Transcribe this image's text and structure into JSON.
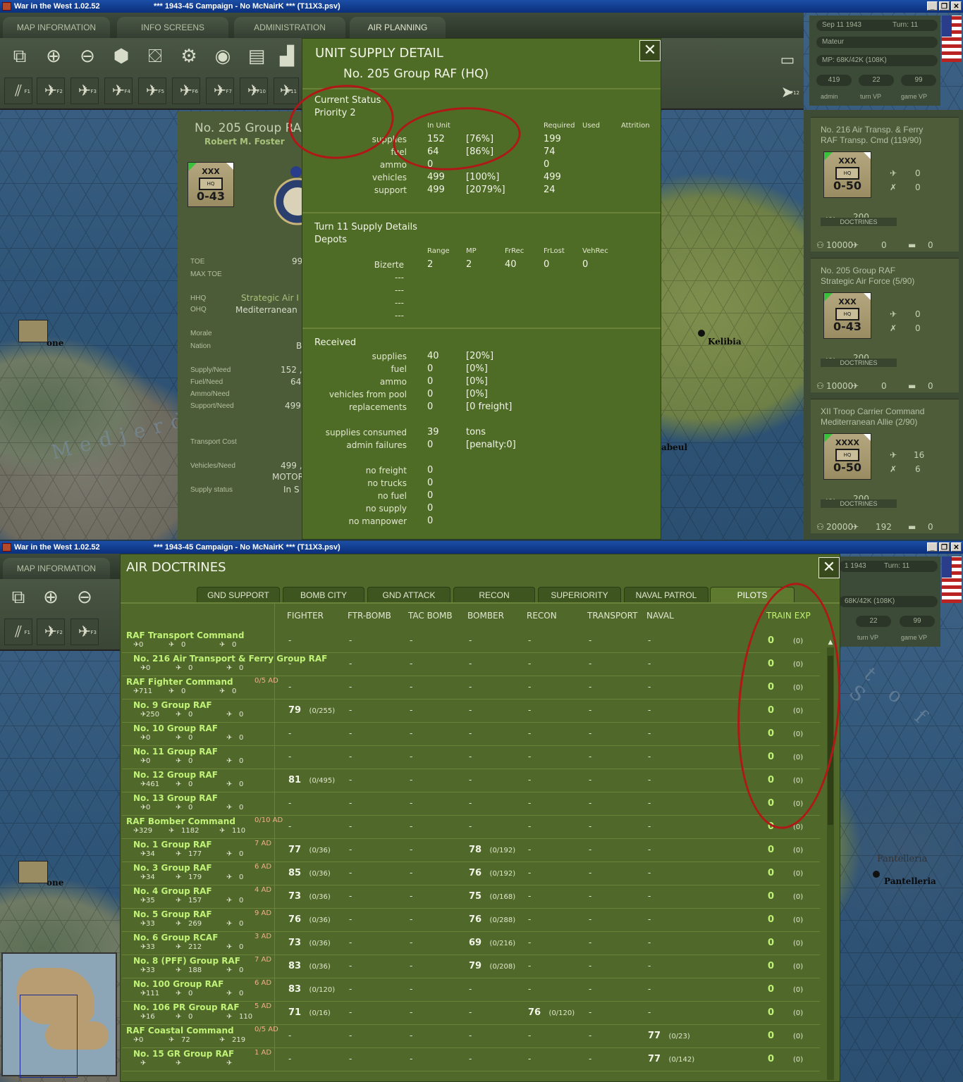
{
  "window1": {
    "app_title": "War in the West  1.02.52",
    "doc_title": "***   1943-45 Campaign - No McNairK  ***   (T11X3.psv)",
    "nav_tabs": [
      "MAP INFORMATION",
      "INFO SCREENS",
      "ADMINISTRATION",
      "AIR PLANNING"
    ],
    "fkeys": [
      "F1",
      "F2",
      "F3",
      "F4",
      "F5",
      "F6",
      "F7",
      "F10",
      "F11",
      "F12"
    ],
    "right_panel": {
      "date": "Sep 11 1943",
      "turn": "Turn: 11",
      "difficulty": "Mateur",
      "mp": "MP: 68K/42K (108K)",
      "admin_val": "419",
      "turn_vp_val": "22",
      "game_vp_val": "99",
      "admin_label": "admin",
      "turn_vp_label": "turn VP",
      "game_vp_label": "game VP"
    },
    "map_labels": {
      "kelibia": "Kelibia",
      "medjerda": "Medjerda",
      "abeul": "abeul",
      "one": "one"
    },
    "unit_panel": {
      "name": "No. 205 Group RA",
      "commander": "Robert M. Foster",
      "counter_size": "XXX",
      "counter_hq": "HQ",
      "counter_str": "0-43",
      "labels": {
        "toe": "TOE",
        "max_toe": "MAX TOE",
        "hhq": "HHQ",
        "ohq": "OHQ",
        "morale": "Morale",
        "nation": "Nation",
        "supply_need": "Supply/Need",
        "fuel_need": "Fuel/Need",
        "ammo_need": "Ammo/Need",
        "support_need": "Support/Need",
        "transport_cost": "Transport Cost",
        "vehicles_need": "Vehicles/Need",
        "supply_status": "Supply status"
      },
      "values": {
        "toe": "99",
        "hhq": "Strategic Air I",
        "ohq": "Mediterranean",
        "nation": "B",
        "supply_need": "152 ,",
        "fuel_need": "64",
        "support_need": "499",
        "vehicles_need": "499 ,",
        "motor": "MOTOR",
        "supply_status": "In S"
      }
    },
    "unit_list": [
      {
        "title1": "No. 216 Air Transp. & Ferry",
        "title2": "RAF Transp. Cmd (119/90)",
        "size": "XXX",
        "hq": "HQ",
        "str": "0-50",
        "air1": "0",
        "air2": "0",
        "support": "200",
        "doctrines": "DOCTRINES",
        "men": "10000",
        "planes": "0",
        "tanks": "0"
      },
      {
        "title1": "No. 205 Group RAF",
        "title2": "Strategic Air Force (5/90)",
        "size": "XXX",
        "hq": "HQ",
        "str": "0-43",
        "air1": "0",
        "air2": "0",
        "support": "200",
        "doctrines": "DOCTRINES",
        "men": "10000",
        "planes": "0",
        "tanks": "0"
      },
      {
        "title1": "XII Troop Carrier Command",
        "title2": "Mediterranean Allie (2/90)",
        "size": "XXXX",
        "hq": "HQ",
        "str": "0-50",
        "air1": "16",
        "air2": "6",
        "support": "200",
        "doctrines": "DOCTRINES",
        "men": "20000",
        "planes": "192",
        "tanks": "0"
      }
    ],
    "supply_dialog": {
      "title": "UNIT SUPPLY DETAIL",
      "unit": "No. 205 Group RAF  (HQ)",
      "close": "✕",
      "current_status": "Current Status",
      "priority": "Priority   2",
      "headers": {
        "in_unit": "In Unit",
        "required": "Required",
        "used": "Used",
        "attrition": "Attrition"
      },
      "status_rows": [
        {
          "label": "supplies",
          "qty": "152",
          "pct": "[76%]",
          "req": "199"
        },
        {
          "label": "fuel",
          "qty": "64",
          "pct": "[86%]",
          "req": "74"
        },
        {
          "label": "ammo",
          "qty": "0",
          "pct": "",
          "req": "0"
        },
        {
          "label": "vehicles",
          "qty": "499",
          "pct": "[100%]",
          "req": "499"
        },
        {
          "label": "support",
          "qty": "499",
          "pct": "[2079%]",
          "req": "24"
        }
      ],
      "turn_details": "Turn 11 Supply Details",
      "depots": "Depots",
      "depot_headers": {
        "range": "Range",
        "mp": "MP",
        "frrec": "FrRec",
        "frlost": "FrLost",
        "vehrec": "VehRec"
      },
      "depot_rows": [
        {
          "name": "Bizerte",
          "range": "2",
          "mp": "2",
          "frrec": "40",
          "frlost": "0",
          "vehrec": "0"
        },
        {
          "name": "---"
        },
        {
          "name": "---"
        },
        {
          "name": "---"
        },
        {
          "name": "---"
        }
      ],
      "received": "Received",
      "received_rows": [
        {
          "label": "supplies",
          "qty": "40",
          "note": "[20%]"
        },
        {
          "label": "fuel",
          "qty": "0",
          "note": "[0%]"
        },
        {
          "label": "ammo",
          "qty": "0",
          "note": "[0%]"
        },
        {
          "label": "vehicles from pool",
          "qty": "0",
          "note": "[0%]"
        },
        {
          "label": "replacements",
          "qty": "0",
          "note": "[0 freight]"
        }
      ],
      "consumed_rows": [
        {
          "label": "supplies consumed",
          "qty": "39",
          "note": "tons"
        },
        {
          "label": "admin failures",
          "qty": "0",
          "note": "[penalty:0]"
        }
      ],
      "failure_rows": [
        {
          "label": "no freight",
          "qty": "0"
        },
        {
          "label": "no trucks",
          "qty": "0"
        },
        {
          "label": "no fuel",
          "qty": "0"
        },
        {
          "label": "no supply",
          "qty": "0"
        },
        {
          "label": "no manpower",
          "qty": "0"
        }
      ]
    }
  },
  "window2": {
    "app_title": "War in the West  1.02.52",
    "doc_title": "***   1943-45 Campaign - No McNairK  ***   (T11X3.psv)",
    "nav_tab": "MAP INFORMATION",
    "right_panel": {
      "date": "1 1943",
      "turn": "Turn: 11",
      "mp": "68K/42K (108K)",
      "turn_vp_val": "22",
      "game_vp_val": "99",
      "turn_vp_label": "turn VP",
      "game_vp_label": "game VP"
    },
    "map_labels": {
      "pantelleria_big": "Pantelleria",
      "pantelleria": "Pantelleria",
      "one": "one",
      "sea": "t o f S"
    },
    "doctrines": {
      "title": "AIR DOCTRINES",
      "close": "✕",
      "tabs": [
        "GND SUPPORT",
        "BOMB CITY",
        "GND ATTACK",
        "RECON",
        "SUPERIORITY",
        "NAVAL PATROL",
        "PILOTS"
      ],
      "columns": [
        "FIGHTER",
        "FTR-BOMB",
        "TAC BOMB",
        "BOMBER",
        "RECON",
        "TRANSPORT",
        "NAVAL",
        "TRAIN EXP"
      ],
      "rows": [
        {
          "name": "RAF Transport Command",
          "indent": false,
          "ad": "",
          "a": "0",
          "b": "0",
          "c": "0",
          "fighter": "",
          "fighter_s": "",
          "bomber": "",
          "bomber_s": "",
          "recon": "",
          "recon_s": "",
          "naval": "",
          "naval_s": "",
          "train": "0",
          "train_s": "(0)"
        },
        {
          "name": "No. 216 Air Transport & Ferry Group RAF",
          "indent": true,
          "ad": "",
          "a": "0",
          "b": "0",
          "c": "0",
          "fighter": "",
          "fighter_s": "",
          "bomber": "",
          "bomber_s": "",
          "recon": "",
          "recon_s": "",
          "naval": "",
          "naval_s": "",
          "train": "0",
          "train_s": "(0)"
        },
        {
          "name": "RAF Fighter Command",
          "indent": false,
          "ad": "0/5 AD",
          "a": "711",
          "b": "0",
          "c": "0",
          "fighter": "",
          "fighter_s": "",
          "bomber": "",
          "bomber_s": "",
          "recon": "",
          "recon_s": "",
          "naval": "",
          "naval_s": "",
          "train": "0",
          "train_s": "(0)"
        },
        {
          "name": "No. 9 Group RAF",
          "indent": true,
          "ad": "",
          "a": "250",
          "b": "0",
          "c": "0",
          "fighter": "79",
          "fighter_s": "(0/255)",
          "bomber": "",
          "bomber_s": "",
          "recon": "",
          "recon_s": "",
          "naval": "",
          "naval_s": "",
          "train": "0",
          "train_s": "(0)"
        },
        {
          "name": "No. 10 Group RAF",
          "indent": true,
          "ad": "",
          "a": "0",
          "b": "0",
          "c": "0",
          "fighter": "",
          "fighter_s": "",
          "bomber": "",
          "bomber_s": "",
          "recon": "",
          "recon_s": "",
          "naval": "",
          "naval_s": "",
          "train": "0",
          "train_s": "(0)"
        },
        {
          "name": "No. 11 Group RAF",
          "indent": true,
          "ad": "",
          "a": "0",
          "b": "0",
          "c": "0",
          "fighter": "",
          "fighter_s": "",
          "bomber": "",
          "bomber_s": "",
          "recon": "",
          "recon_s": "",
          "naval": "",
          "naval_s": "",
          "train": "0",
          "train_s": "(0)"
        },
        {
          "name": "No. 12 Group RAF",
          "indent": true,
          "ad": "",
          "a": "461",
          "b": "0",
          "c": "0",
          "fighter": "81",
          "fighter_s": "(0/495)",
          "bomber": "",
          "bomber_s": "",
          "recon": "",
          "recon_s": "",
          "naval": "",
          "naval_s": "",
          "train": "0",
          "train_s": "(0)"
        },
        {
          "name": "No. 13 Group RAF",
          "indent": true,
          "ad": "",
          "a": "0",
          "b": "0",
          "c": "0",
          "fighter": "",
          "fighter_s": "",
          "bomber": "",
          "bomber_s": "",
          "recon": "",
          "recon_s": "",
          "naval": "",
          "naval_s": "",
          "train": "0",
          "train_s": "(0)"
        },
        {
          "name": "RAF Bomber Command",
          "indent": false,
          "ad": "0/10 AD",
          "a": "329",
          "b": "1182",
          "c": "110",
          "fighter": "",
          "fighter_s": "",
          "bomber": "",
          "bomber_s": "",
          "recon": "",
          "recon_s": "",
          "naval": "",
          "naval_s": "",
          "train": "0",
          "train_s": "(0)"
        },
        {
          "name": "No. 1 Group RAF",
          "indent": true,
          "ad": "7 AD",
          "a": "34",
          "b": "177",
          "c": "0",
          "fighter": "77",
          "fighter_s": "(0/36)",
          "bomber": "78",
          "bomber_s": "(0/192)",
          "recon": "",
          "recon_s": "",
          "naval": "",
          "naval_s": "",
          "train": "0",
          "train_s": "(0)"
        },
        {
          "name": "No. 3 Group RAF",
          "indent": true,
          "ad": "6 AD",
          "a": "34",
          "b": "179",
          "c": "0",
          "fighter": "85",
          "fighter_s": "(0/36)",
          "bomber": "76",
          "bomber_s": "(0/192)",
          "recon": "",
          "recon_s": "",
          "naval": "",
          "naval_s": "",
          "train": "0",
          "train_s": "(0)"
        },
        {
          "name": "No. 4 Group RAF",
          "indent": true,
          "ad": "4 AD",
          "a": "35",
          "b": "157",
          "c": "0",
          "fighter": "73",
          "fighter_s": "(0/36)",
          "bomber": "75",
          "bomber_s": "(0/168)",
          "recon": "",
          "recon_s": "",
          "naval": "",
          "naval_s": "",
          "train": "0",
          "train_s": "(0)"
        },
        {
          "name": "No. 5 Group RAF",
          "indent": true,
          "ad": "9 AD",
          "a": "33",
          "b": "269",
          "c": "0",
          "fighter": "76",
          "fighter_s": "(0/36)",
          "bomber": "76",
          "bomber_s": "(0/288)",
          "recon": "",
          "recon_s": "",
          "naval": "",
          "naval_s": "",
          "train": "0",
          "train_s": "(0)"
        },
        {
          "name": "No. 6 Group RCAF",
          "indent": true,
          "ad": "3 AD",
          "a": "33",
          "b": "212",
          "c": "0",
          "fighter": "73",
          "fighter_s": "(0/36)",
          "bomber": "69",
          "bomber_s": "(0/216)",
          "recon": "",
          "recon_s": "",
          "naval": "",
          "naval_s": "",
          "train": "0",
          "train_s": "(0)"
        },
        {
          "name": "No. 8 (PFF) Group RAF",
          "indent": true,
          "ad": "7 AD",
          "a": "33",
          "b": "188",
          "c": "0",
          "fighter": "83",
          "fighter_s": "(0/36)",
          "bomber": "79",
          "bomber_s": "(0/208)",
          "recon": "",
          "recon_s": "",
          "naval": "",
          "naval_s": "",
          "train": "0",
          "train_s": "(0)"
        },
        {
          "name": "No. 100 Group RAF",
          "indent": true,
          "ad": "6 AD",
          "a": "111",
          "b": "0",
          "c": "0",
          "fighter": "83",
          "fighter_s": "(0/120)",
          "bomber": "",
          "bomber_s": "",
          "recon": "",
          "recon_s": "",
          "naval": "",
          "naval_s": "",
          "train": "0",
          "train_s": "(0)"
        },
        {
          "name": "No. 106 PR Group RAF",
          "indent": true,
          "ad": "5 AD",
          "a": "16",
          "b": "0",
          "c": "110",
          "fighter": "71",
          "fighter_s": "(0/16)",
          "bomber": "",
          "bomber_s": "",
          "recon": "76",
          "recon_s": "(0/120)",
          "naval": "",
          "naval_s": "",
          "train": "0",
          "train_s": "(0)"
        },
        {
          "name": "RAF Coastal Command",
          "indent": false,
          "ad": "0/5 AD",
          "a": "0",
          "b": "72",
          "c": "219",
          "fighter": "",
          "fighter_s": "",
          "bomber": "",
          "bomber_s": "",
          "recon": "",
          "recon_s": "",
          "naval": "77",
          "naval_s": "(0/23)",
          "train": "0",
          "train_s": "(0)"
        },
        {
          "name": "No. 15 GR Group RAF",
          "indent": true,
          "ad": "1 AD",
          "a": "",
          "b": "",
          "c": "",
          "fighter": "",
          "fighter_s": "",
          "bomber": "",
          "bomber_s": "",
          "recon": "",
          "recon_s": "",
          "naval": "77",
          "naval_s": "(0/142)",
          "train": "0",
          "train_s": "(0)"
        }
      ]
    }
  }
}
